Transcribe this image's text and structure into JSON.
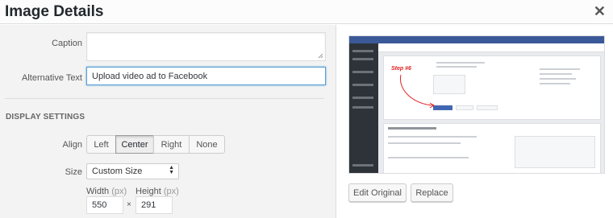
{
  "header": {
    "title": "Image Details",
    "close_icon": "close-icon"
  },
  "form": {
    "caption_label": "Caption",
    "caption_value": "",
    "alt_label": "Alternative Text",
    "alt_value": "Upload video ad to Facebook",
    "display_settings_heading": "DISPLAY SETTINGS",
    "align_label": "Align",
    "align_options": [
      "Left",
      "Center",
      "Right",
      "None"
    ],
    "align_selected": "Center",
    "size_label": "Size",
    "size_value": "Custom Size",
    "width_label": "Width",
    "height_label": "Height",
    "unit": "(px)",
    "width_value": "550",
    "height_value": "291",
    "times": "×"
  },
  "preview": {
    "step_annotation": "Step #6",
    "edit_original": "Edit Original",
    "replace": "Replace"
  }
}
